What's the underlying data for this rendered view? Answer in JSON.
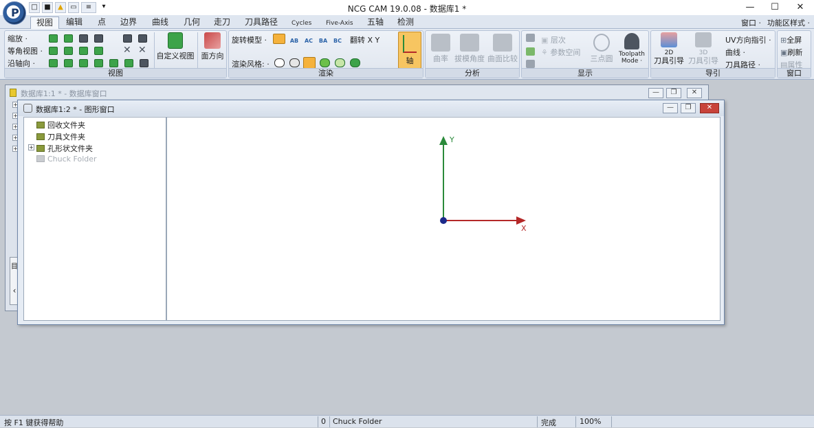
{
  "window": {
    "title": "NCG CAM 19.0.08 - 数据库1 *",
    "controls": [
      "—",
      "☐",
      "✕"
    ]
  },
  "quick_access": [
    "□",
    "■",
    "▲",
    "▭",
    "≡",
    "▾"
  ],
  "menu": {
    "tabs": [
      "视图",
      "编辑",
      "点",
      "边界",
      "曲线",
      "几何",
      "走刀",
      "刀具路径",
      "Cycles",
      "Five-Axis",
      "五轴",
      "检测"
    ],
    "right": [
      "窗口 ·",
      "功能区样式 ·"
    ]
  },
  "ribbon": {
    "view": {
      "rows": [
        "缩放 ·",
        "等角视图 ·",
        "沿轴向 ·"
      ],
      "custom_view": "自定义视图",
      "face_direction": "面方向",
      "label": "视图"
    },
    "render": {
      "rotate_model": "旋转模型 ·",
      "ab": "AB",
      "ac": "AC",
      "ba": "BA",
      "bc": "BC",
      "flip": "翻转 X Y",
      "render_style": "渲染风格: ·",
      "axis": "轴",
      "label": "渲染"
    },
    "analysis": {
      "curvature": "曲率",
      "draft_angle": "拔模角度",
      "surface_compare": "曲面比较",
      "label": "分析"
    },
    "display": {
      "layer": "层次",
      "param_space": "参数空间",
      "three_point": "三点圆",
      "toolpath_mode": "Toolpath Mode ·",
      "label": "显示"
    },
    "guide": {
      "guide_2d_top": "2D",
      "guide_2d": "刀具引导",
      "guide_3d_top": "3D",
      "guide_3d": "刀具引导",
      "uv_guide": "UV方向指引 ·",
      "curve": "曲线 ·",
      "toolpath": "刀具路径 ·",
      "label": "导引"
    },
    "window": {
      "fullscreen": "全屏",
      "refresh": "刷新",
      "properties": "属性",
      "label": "窗口"
    }
  },
  "win_db": {
    "title": "数据库1:1 * - 数据库窗口",
    "strip_top": "目",
    "strip_bottom": "‹"
  },
  "win_graphics": {
    "title": "数据库1:2 * - 图形窗口",
    "tree": [
      {
        "label": "回收文件夹",
        "expand": ""
      },
      {
        "label": "刀具文件夹",
        "expand": ""
      },
      {
        "label": "孔形状文件夹",
        "expand": "+"
      },
      {
        "label": "Chuck Folder",
        "expand": ""
      }
    ],
    "axis_x": "X",
    "axis_y": "Y"
  },
  "status": {
    "help": "按 F1 键获得帮助",
    "count": "0",
    "selection": "Chuck Folder",
    "state": "完成",
    "zoom": "100%"
  },
  "colors": {
    "axis_x": "#b42828",
    "axis_y": "#2a8a3a",
    "origin": "#1c2a8a",
    "accent_orange": "#f5b23c"
  }
}
